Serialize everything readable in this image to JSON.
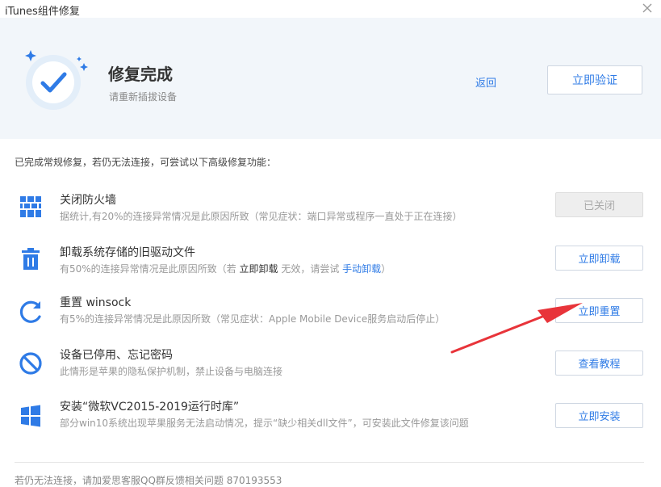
{
  "window": {
    "title": "iTunes组件修复"
  },
  "header": {
    "title": "修复完成",
    "subtitle": "请重新插拔设备",
    "back_label": "返回",
    "verify_label": "立即验证"
  },
  "intro": "已完成常规修复，若仍无法连接，可尝试以下高级修复功能：",
  "items": [
    {
      "icon": "firewall-icon",
      "title": "关闭防火墙",
      "desc": "据统计,有20%的连接异常情况是此原因所致（常见症状：端口异常或程序一直处于正在连接）",
      "button": "已关闭",
      "disabled": true
    },
    {
      "icon": "trash-icon",
      "title": "卸载系统存储的旧驱动文件",
      "desc_prefix": "有50%的连接异常情况是此原因所致（若 ",
      "desc_em": "立即卸载",
      "desc_mid": " 无效，请尝试 ",
      "desc_link": "手动卸载",
      "desc_suffix": "）",
      "button": "立即卸载"
    },
    {
      "icon": "refresh-icon",
      "title": "重置 winsock",
      "desc": "有5%的连接异常情况是此原因所致（常见症状：Apple Mobile Device服务启动后停止）",
      "button": "立即重置"
    },
    {
      "icon": "prohibited-icon",
      "title": "设备已停用、忘记密码",
      "desc": "此情形是苹果的隐私保护机制，禁止设备与电脑连接",
      "button": "查看教程"
    },
    {
      "icon": "windows-icon",
      "title": "安装“微软VC2015-2019运行时库”",
      "desc": "部分win10系统出现苹果服务无法启动情况，提示“缺少相关dll文件”，可安装此文件修复该问题",
      "button": "立即安装"
    }
  ],
  "footer": "若仍无法连接，请加爱思客服QQ群反馈相关问题  870193553",
  "colors": {
    "accent": "#2f7be6",
    "header_bg": "#f2f6fa",
    "arrow": "#e8343a"
  }
}
